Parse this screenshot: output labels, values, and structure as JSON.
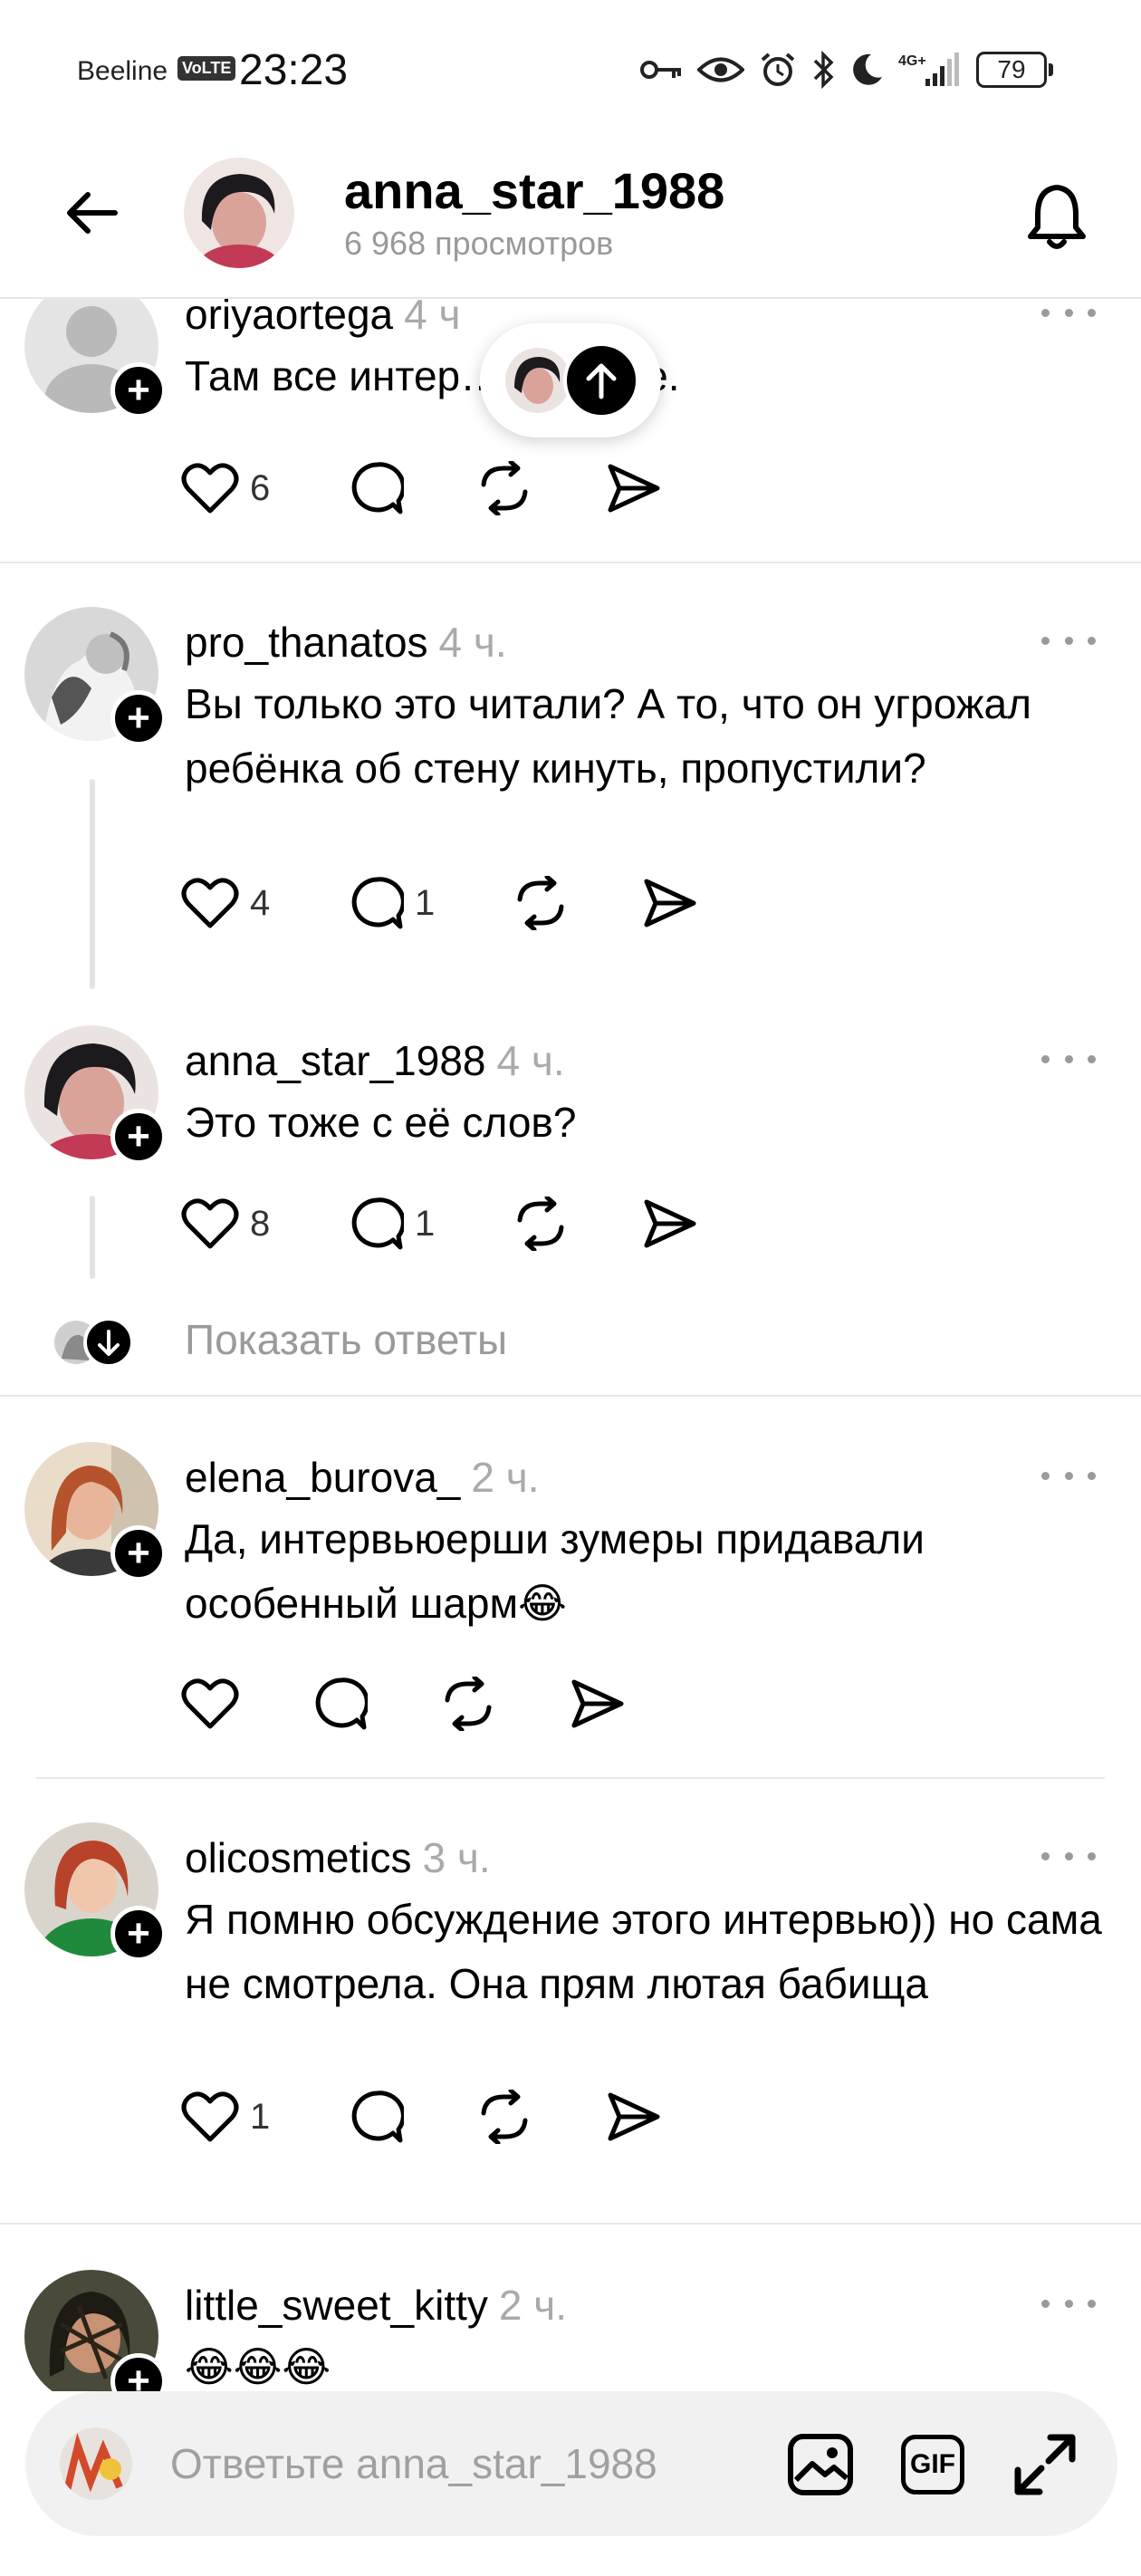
{
  "status_bar": {
    "carrier": "Beeline",
    "volte": "VoLTE",
    "time": "23:23",
    "network": "4G+",
    "battery": "79"
  },
  "header": {
    "title": "anna_star_1988",
    "views": "6 968 просмотров"
  },
  "floating_pill": {
    "icon": "arrow-up-icon"
  },
  "comments": [
    {
      "username": "oriyaortega",
      "time": "4 ч",
      "text": "Там все интер… красное.",
      "likes": "6",
      "replies": ""
    },
    {
      "username": "pro_thanatos",
      "time": "4 ч.",
      "text": "Вы только это читали? А то, что он угрожал ребёнка об стену кинуть, пропустили?",
      "likes": "4",
      "replies": "1"
    },
    {
      "username": "anna_star_1988",
      "time": "4 ч.",
      "text": "Это тоже с её слов?",
      "likes": "8",
      "replies": "1"
    },
    {
      "username": "elena_burova_",
      "time": "2 ч.",
      "text": "Да, интервьюерши зумеры придавали особенный шарм😂",
      "likes": "",
      "replies": ""
    },
    {
      "username": "olicosmetics",
      "time": "3 ч.",
      "text": "Я помню обсуждение этого интервью)) но сама не смотрела. Она прям лютая бабища",
      "likes": "1",
      "replies": ""
    },
    {
      "username": "little_sweet_kitty",
      "time": "2 ч.",
      "text": "😂😂😂",
      "likes": "",
      "replies": ""
    }
  ],
  "show_replies_label": "Показать ответы",
  "composer": {
    "placeholder": "Ответьте anna_star_1988",
    "gif_label": "GIF"
  },
  "colors": {
    "text": "#000000",
    "muted": "#9a9a9a",
    "divider": "#e8e8e8",
    "composer_bg": "#f1f1f1"
  }
}
